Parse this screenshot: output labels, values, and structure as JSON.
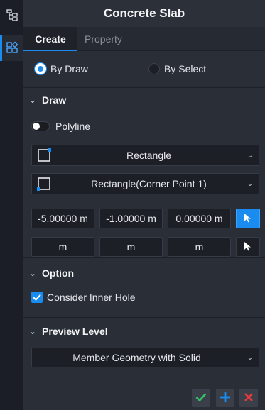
{
  "rail": {
    "items": [
      {
        "icon": "tree-icon"
      },
      {
        "icon": "grid-icon"
      }
    ]
  },
  "panel": {
    "title": "Concrete Slab",
    "tabs": [
      {
        "label": "Create"
      },
      {
        "label": "Property"
      }
    ],
    "mode": {
      "by_draw": "By Draw",
      "by_select": "By Select",
      "selected": "By Draw"
    },
    "draw": {
      "header": "Draw",
      "polyline_label": "Polyline",
      "polyline_on": false,
      "shape_select": "Rectangle",
      "method_select": "Rectangle(Corner Point 1)",
      "coords": [
        "-5.00000 m",
        "-1.00000 m",
        "0.00000 m"
      ],
      "units": [
        "m",
        "m",
        "m"
      ]
    },
    "option": {
      "header": "Option",
      "inner_hole_label": "Consider Inner Hole",
      "inner_hole_checked": true
    },
    "preview": {
      "header": "Preview Level",
      "level": "Member Geometry with Solid"
    },
    "colors": {
      "accent": "#1a8cf0",
      "confirm": "#36c06a",
      "add": "#1a8cf0",
      "cancel": "#e23b3b"
    }
  }
}
